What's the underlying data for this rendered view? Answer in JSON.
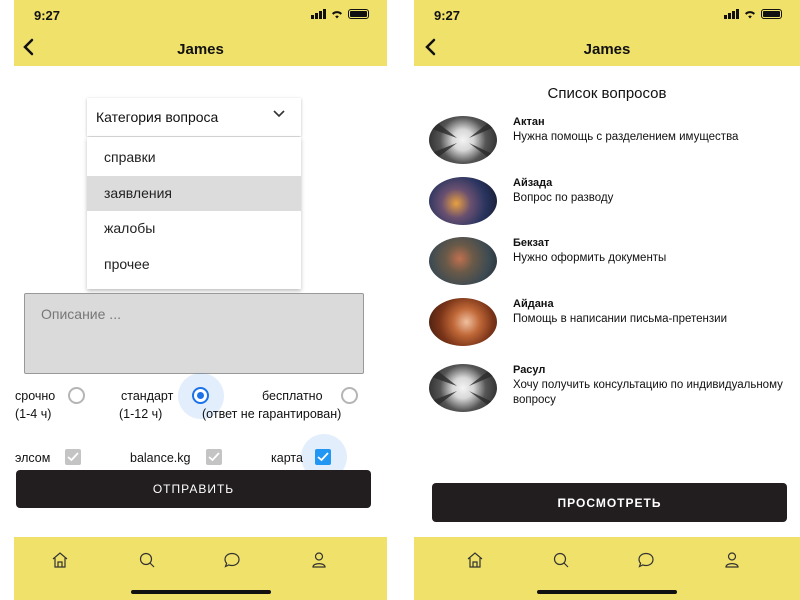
{
  "left": {
    "status_time": "9:27",
    "nav_title": "James",
    "category_select": {
      "label": "Категория вопроса",
      "options": [
        "справки",
        "заявления",
        "жалобы",
        "прочее"
      ],
      "highlighted": "заявления"
    },
    "description_placeholder": "Описание ...",
    "urgency": [
      {
        "label": "срочно",
        "note": "(1-4 ч)",
        "selected": false
      },
      {
        "label": "стандарт",
        "note": "(1-12 ч)",
        "selected": true
      },
      {
        "label": "бесплатно",
        "note": "(ответ не гарантирован)",
        "selected": false
      }
    ],
    "payment": [
      {
        "label": "элсом",
        "checked": false
      },
      {
        "label": "balance.kg",
        "checked": false
      },
      {
        "label": "карта",
        "checked": true
      }
    ],
    "submit_label": "ОТПРАВИТЬ"
  },
  "right": {
    "status_time": "9:27",
    "nav_title": "James",
    "list_title": "Список вопросов",
    "questions": [
      {
        "name": "Актан",
        "text": "Нужна помощь с разделением имущества",
        "avatar": "buildings"
      },
      {
        "name": "Айзада",
        "text": "Вопрос по разводу",
        "avatar": "portrait-dark"
      },
      {
        "name": "Бекзат",
        "text": "Нужно оформить документы",
        "avatar": "person-outdoor"
      },
      {
        "name": "Айдана",
        "text": "Помощь в написании письма-претензии",
        "avatar": "portrait-woman"
      },
      {
        "name": "Расул",
        "text": "Хочу получить консультацию по индивидуальному вопросу",
        "avatar": "buildings"
      }
    ],
    "view_label": "ПРОСМОТРЕТЬ"
  },
  "tabs": [
    "home-icon",
    "search-icon",
    "chat-icon",
    "profile-icon"
  ],
  "colors": {
    "brand_yellow": "#f0e16a",
    "button_dark": "#221e1f",
    "accent_blue": "#1a73e8"
  }
}
